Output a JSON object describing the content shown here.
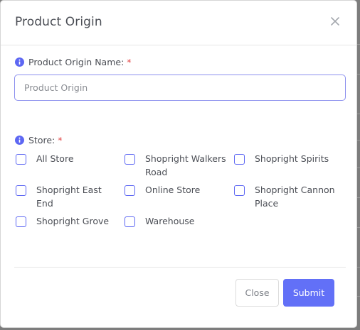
{
  "modal": {
    "title": "Product Origin",
    "close_icon": "close-x-icon"
  },
  "name_field": {
    "label": "Product Origin Name:",
    "required_mark": "*",
    "placeholder": "Product Origin",
    "value": "",
    "info_icon": "info-circle-icon"
  },
  "store_field": {
    "label": "Store:",
    "required_mark": "*",
    "info_icon": "info-circle-icon",
    "options": [
      {
        "label": "All Store",
        "checked": false
      },
      {
        "label": "Shopright Walkers Road",
        "checked": false
      },
      {
        "label": "Shopright Spirits",
        "checked": false
      },
      {
        "label": "Shopright East End",
        "checked": false
      },
      {
        "label": "Online Store",
        "checked": false
      },
      {
        "label": "Shopright Cannon Place",
        "checked": false
      },
      {
        "label": "Shopright Grove",
        "checked": false
      },
      {
        "label": "Warehouse",
        "checked": false
      }
    ]
  },
  "footer": {
    "close_label": "Close",
    "submit_label": "Submit"
  },
  "colors": {
    "accent": "#6270f7",
    "required": "#e24545",
    "info": "#5d67f3"
  }
}
